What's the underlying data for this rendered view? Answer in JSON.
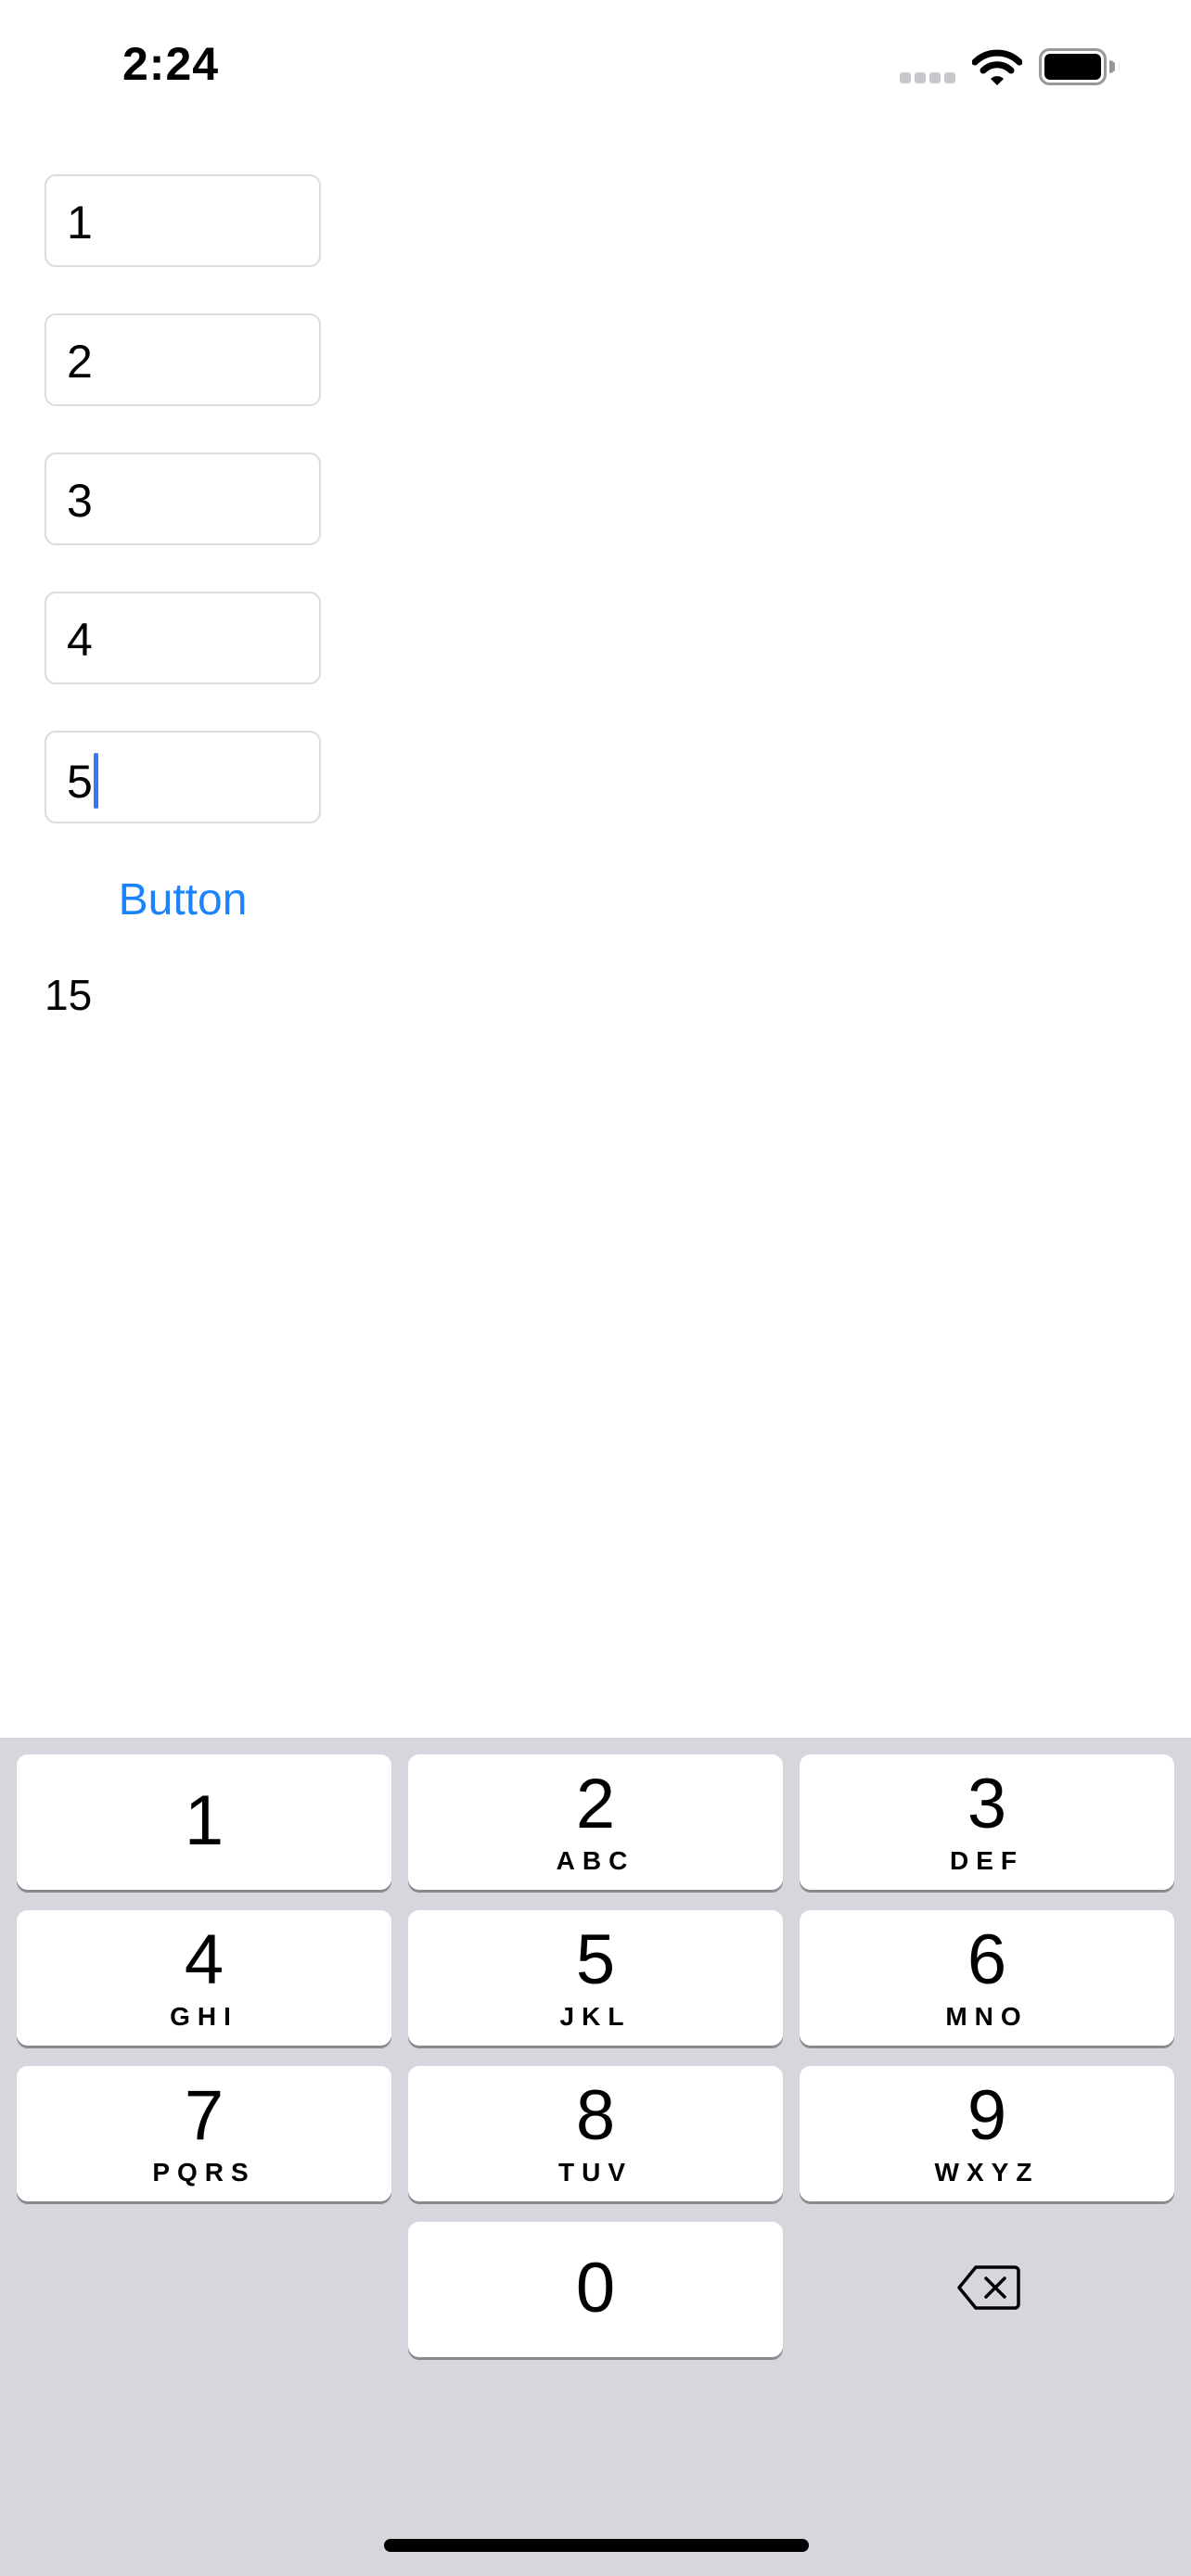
{
  "status_bar": {
    "time": "2:24",
    "icons": [
      "signal-icon",
      "wifi-icon",
      "battery-icon"
    ]
  },
  "form": {
    "fields": [
      {
        "value": "1"
      },
      {
        "value": "2"
      },
      {
        "value": "3"
      },
      {
        "value": "4"
      },
      {
        "value": "5"
      }
    ],
    "button_label": "Button",
    "result": "15"
  },
  "keyboard": {
    "keys": [
      {
        "digit": "1",
        "letters": ""
      },
      {
        "digit": "2",
        "letters": "ABC"
      },
      {
        "digit": "3",
        "letters": "DEF"
      },
      {
        "digit": "4",
        "letters": "GHI"
      },
      {
        "digit": "5",
        "letters": "JKL"
      },
      {
        "digit": "6",
        "letters": "MNO"
      },
      {
        "digit": "7",
        "letters": "PQRS"
      },
      {
        "digit": "8",
        "letters": "TUV"
      },
      {
        "digit": "9",
        "letters": "WXYZ"
      },
      {
        "digit": "0",
        "letters": ""
      }
    ],
    "delete_icon": "backspace-icon"
  },
  "colors": {
    "accent": "#1a84ff",
    "caret": "#3478f6",
    "keyboard_background": "#d6d7dc",
    "field_border": "#dcdcdf"
  }
}
